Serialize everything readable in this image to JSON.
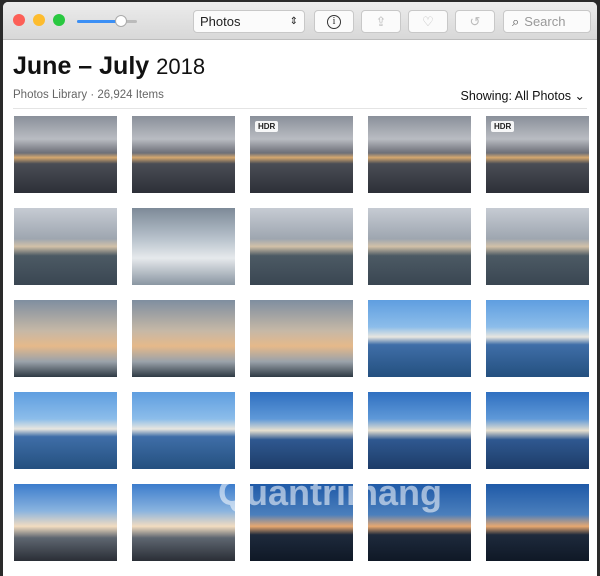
{
  "toolbar": {
    "source_select": "Photos",
    "search_placeholder": "Search",
    "info_icon": "info-icon",
    "share_icon": "share-icon",
    "heart_icon": "heart-icon",
    "rotate_icon": "rotate-icon"
  },
  "zoom_slider": {
    "value": 0.75
  },
  "header": {
    "title": "June – July",
    "year": "2018",
    "subtitle": "Photos Library · 26,924 Items",
    "showing": "Showing: All Photos"
  },
  "photos": [
    {
      "tone": "dusk",
      "hdr": ""
    },
    {
      "tone": "dusk",
      "hdr": ""
    },
    {
      "tone": "dusk",
      "hdr": "HDR"
    },
    {
      "tone": "dusk",
      "hdr": ""
    },
    {
      "tone": "dusk",
      "hdr": "HDR"
    },
    {
      "tone": "grey",
      "hdr": ""
    },
    {
      "tone": "cloud",
      "hdr": ""
    },
    {
      "tone": "grey",
      "hdr": ""
    },
    {
      "tone": "grey",
      "hdr": ""
    },
    {
      "tone": "grey",
      "hdr": ""
    },
    {
      "tone": "warm",
      "hdr": ""
    },
    {
      "tone": "warm",
      "hdr": ""
    },
    {
      "tone": "warm",
      "hdr": ""
    },
    {
      "tone": "blue",
      "hdr": ""
    },
    {
      "tone": "blue",
      "hdr": ""
    },
    {
      "tone": "blue",
      "hdr": ""
    },
    {
      "tone": "blue",
      "hdr": ""
    },
    {
      "tone": "deep",
      "hdr": ""
    },
    {
      "tone": "deep",
      "hdr": ""
    },
    {
      "tone": "deep",
      "hdr": ""
    },
    {
      "tone": "sunset",
      "hdr": ""
    },
    {
      "tone": "sunset",
      "hdr": ""
    },
    {
      "tone": "night",
      "hdr": ""
    },
    {
      "tone": "night",
      "hdr": ""
    },
    {
      "tone": "night",
      "hdr": ""
    }
  ],
  "watermark": "Quantrimang"
}
